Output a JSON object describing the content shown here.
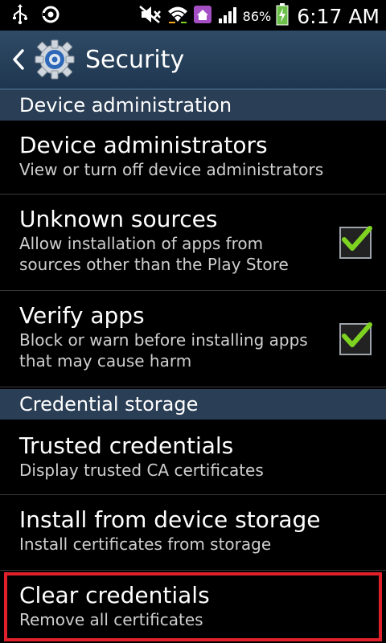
{
  "status_bar": {
    "time": "6:17 AM",
    "battery_percent": "86%",
    "icons": [
      "usb-icon",
      "sync-icon",
      "mute-icon",
      "wifi-icon",
      "home-icon",
      "signal-icon",
      "battery-charging-icon"
    ]
  },
  "action_bar": {
    "title": "Security",
    "back_icon": "chevron-left-icon",
    "app_icon": "settings-gear-icon"
  },
  "sections": {
    "device_admin": {
      "header": "Device administration"
    },
    "credential_storage": {
      "header": "Credential storage"
    }
  },
  "items": {
    "device_administrators": {
      "title": "Device administrators",
      "summary": "View or turn off device administrators"
    },
    "unknown_sources": {
      "title": "Unknown sources",
      "summary_line1": "Allow installation of apps from",
      "summary_line2": "sources other than the Play Store",
      "checked": true
    },
    "verify_apps": {
      "title": "Verify apps",
      "summary_line1": "Block or warn before installing apps",
      "summary_line2": "that may cause harm",
      "checked": true
    },
    "trusted_credentials": {
      "title": "Trusted credentials",
      "summary": "Display trusted CA certificates"
    },
    "install_from_storage": {
      "title": "Install from device storage",
      "summary": "Install certificates from storage"
    },
    "clear_credentials": {
      "title": "Clear credentials",
      "summary": "Remove all certificates"
    }
  },
  "colors": {
    "action_bar": "#2f4b66",
    "section_header": "#2a3e55",
    "checkmark": "#7ed321",
    "highlight": "#e0212b"
  }
}
